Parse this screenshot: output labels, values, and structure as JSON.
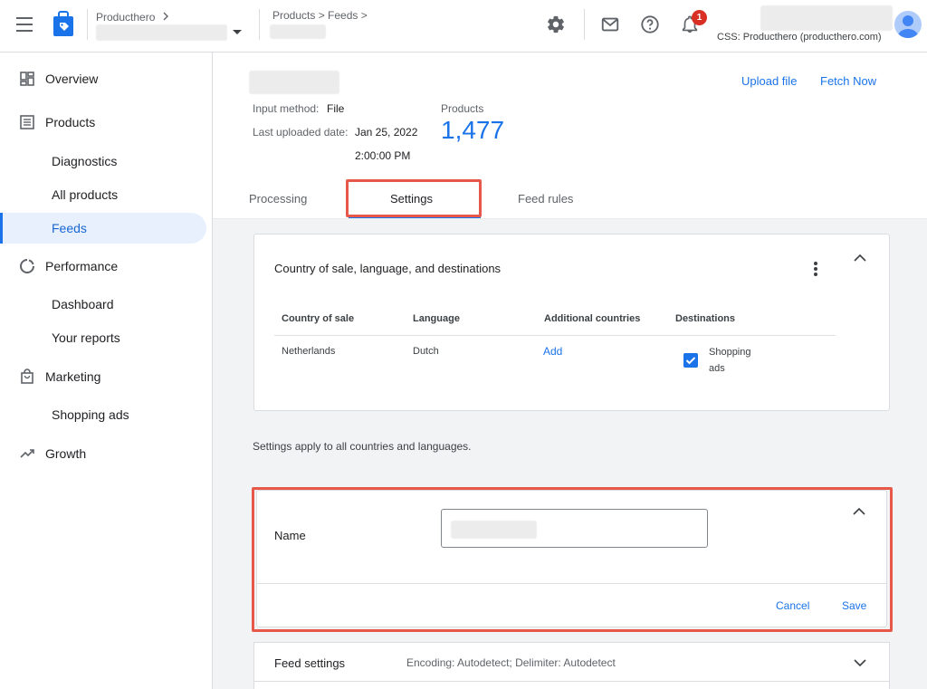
{
  "topbar": {
    "account_label": "Producthero",
    "breadcrumb": "Products > Feeds >",
    "notification_count": "1",
    "css_label": "CSS: Producthero (producthero.com)"
  },
  "sidebar": {
    "items": [
      {
        "label": "Overview"
      },
      {
        "label": "Products"
      },
      {
        "label": "Diagnostics"
      },
      {
        "label": "All products"
      },
      {
        "label": "Feeds"
      },
      {
        "label": "Performance"
      },
      {
        "label": "Dashboard"
      },
      {
        "label": "Your reports"
      },
      {
        "label": "Marketing"
      },
      {
        "label": "Shopping ads"
      },
      {
        "label": "Growth"
      }
    ]
  },
  "header": {
    "input_method_label": "Input method:",
    "input_method_value": "File",
    "last_uploaded_label": "Last uploaded date:",
    "last_uploaded_date": "Jan 25, 2022",
    "last_uploaded_time": "2:00:00 PM",
    "products_label": "Products",
    "products_count": "1,477",
    "upload_file": "Upload file",
    "fetch_now": "Fetch Now"
  },
  "tabs": [
    {
      "label": "Processing"
    },
    {
      "label": "Settings"
    },
    {
      "label": "Feed rules"
    }
  ],
  "country_card": {
    "title": "Country of sale, language, and destinations",
    "columns": [
      "Country of sale",
      "Language",
      "Additional countries",
      "Destinations"
    ],
    "row": {
      "country": "Netherlands",
      "language": "Dutch",
      "additional": "Add",
      "destination_line1": "Shopping",
      "destination_line2": "ads"
    }
  },
  "settings_note": "Settings apply to all countries and languages.",
  "name_card": {
    "label": "Name",
    "cancel": "Cancel",
    "save": "Save"
  },
  "feed_settings": {
    "title": "Feed settings",
    "summary": "Encoding: Autodetect; Delimiter: Autodetect"
  },
  "colors": {
    "accent": "#1a73e8",
    "highlight": "#e8584a",
    "badge": "#d93025"
  }
}
